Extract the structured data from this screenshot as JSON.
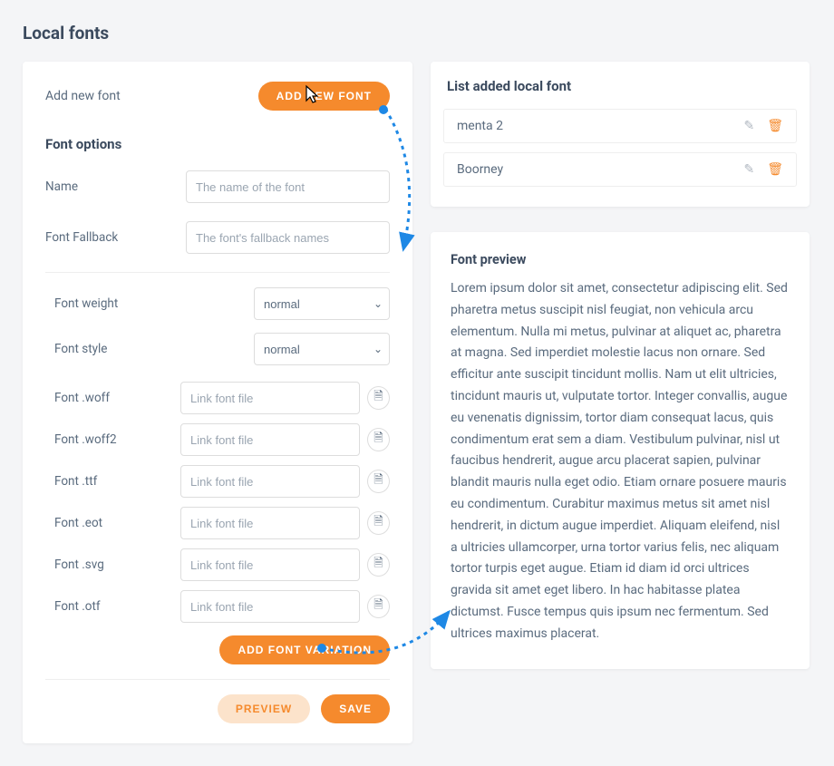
{
  "page": {
    "title": "Local fonts"
  },
  "addRow": {
    "label": "Add new font",
    "button": "ADD NEW FONT"
  },
  "fontOptions": {
    "title": "Font options",
    "nameLabel": "Name",
    "namePlaceholder": "The name of the font",
    "fallbackLabel": "Font Fallback",
    "fallbackPlaceholder": "The font's fallback names"
  },
  "variation": {
    "weightLabel": "Font weight",
    "weightValue": "normal",
    "styleLabel": "Font style",
    "styleValue": "normal",
    "filePlaceholder": "Link font file",
    "formats": [
      {
        "label": "Font .woff"
      },
      {
        "label": "Font .woff2"
      },
      {
        "label": "Font .ttf"
      },
      {
        "label": "Font .eot"
      },
      {
        "label": "Font .svg"
      },
      {
        "label": "Font .otf"
      }
    ],
    "addVariationButton": "ADD FONT VARIATION"
  },
  "finalActions": {
    "preview": "PREVIEW",
    "save": "SAVE"
  },
  "list": {
    "title": "List added local font",
    "items": [
      {
        "name": "menta 2"
      },
      {
        "name": "Boorney"
      }
    ]
  },
  "preview": {
    "title": "Font preview",
    "body": "Lorem ipsum dolor sit amet, consectetur adipiscing elit. Sed pharetra metus suscipit nisl feugiat, non vehicula arcu elementum. Nulla mi metus, pulvinar at aliquet ac, pharetra at magna. Sed imperdiet molestie lacus non ornare. Sed efficitur ante suscipit tincidunt mollis. Nam ut elit ultricies, tincidunt mauris ut, vulputate tortor. Integer convallis, augue eu venenatis dignissim, tortor diam consequat lacus, quis condimentum erat sem a diam. Vestibulum pulvinar, nisl ut faucibus hendrerit, augue arcu placerat sapien, pulvinar blandit mauris nulla eget odio. Etiam ornare posuere mauris eu condimentum. Curabitur maximus metus sit amet nisl hendrerit, in dictum augue imperdiet. Aliquam eleifend, nisl a ultricies ullamcorper, urna tortor varius felis, nec aliquam tortor turpis eget augue. Etiam id diam id orci ultrices gravida sit amet eget libero. In hac habitasse platea dictumst. Fusce tempus quis ipsum nec fermentum. Sed ultrices maximus placerat."
  }
}
